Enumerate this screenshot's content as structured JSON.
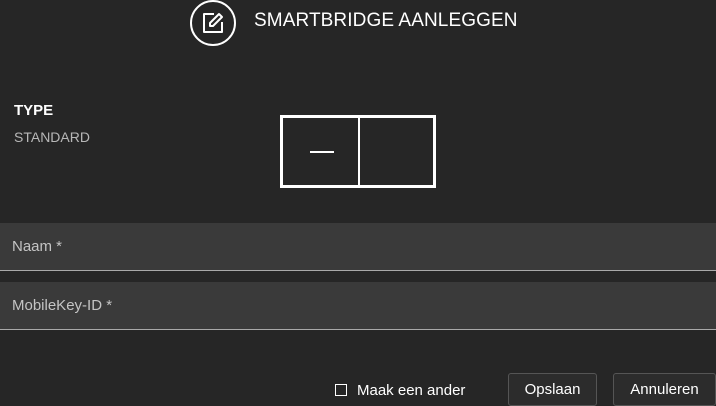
{
  "header": {
    "title": "SMARTBRIDGE AANLEGGEN",
    "icon": "edit-icon"
  },
  "type_section": {
    "label": "TYPE",
    "value": "STANDARD"
  },
  "form": {
    "naam_placeholder": "Naam *",
    "naam_value": "",
    "mobilekey_placeholder": "MobileKey-ID *",
    "mobilekey_value": ""
  },
  "footer": {
    "create_another_label": "Maak een ander",
    "create_another_checked": false,
    "save_label": "Opslaan",
    "cancel_label": "Annuleren"
  },
  "colors": {
    "background": "#262626",
    "field_background": "#3a3a3a",
    "text": "#ffffff",
    "muted_text": "#b7b7b7"
  }
}
